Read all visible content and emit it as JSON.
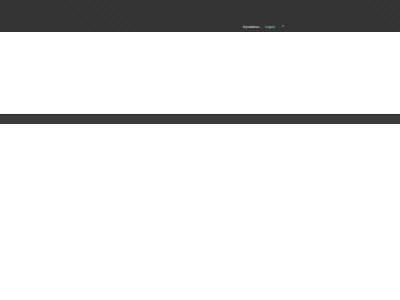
{
  "topbar": {
    "links": {
      "main_label": "hyvaisivo",
      "accent_label": "logon"
    }
  },
  "colors": {
    "topbar_bg": "#333333",
    "band_bg": "#3c3c3c",
    "accent": "#8fd1c4"
  },
  "icons": {
    "dropdown": "chevron-down-icon"
  }
}
